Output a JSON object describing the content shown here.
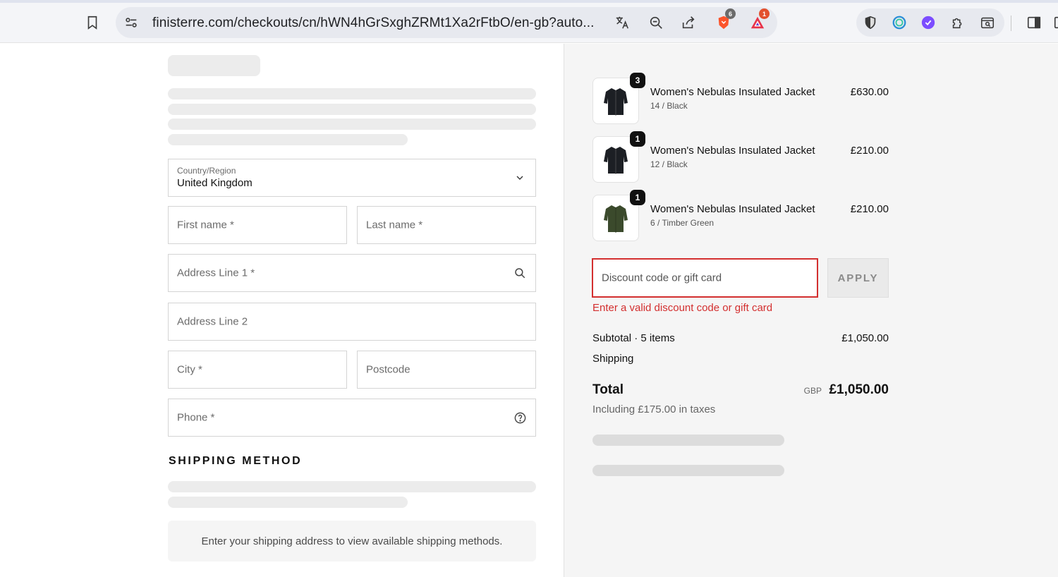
{
  "browser": {
    "url": "finisterre.com/checkouts/cn/hWN4hGrSxghZRMt1Xa2rFtbO/en-gb?auto...",
    "brave_badge": "6",
    "rewards_badge": "1",
    "icons": [
      "bookmark-icon",
      "site-settings-icon",
      "translate-icon",
      "zoom-out-icon",
      "share-icon",
      "brave-shields-icon",
      "brave-rewards-icon",
      "shield-extension-icon",
      "circle-extension-icon",
      "purple-extension-icon",
      "extensions-puzzle-icon",
      "tab-search-icon",
      "sidebar-icon"
    ]
  },
  "form": {
    "country_label": "Country/Region",
    "country_value": "United Kingdom",
    "first_name_placeholder": "First name *",
    "last_name_placeholder": "Last name *",
    "address1_placeholder": "Address Line 1 *",
    "address2_placeholder": "Address Line 2",
    "city_placeholder": "City *",
    "postcode_placeholder": "Postcode",
    "phone_placeholder": "Phone *"
  },
  "shipping": {
    "title": "SHIPPING METHOD",
    "note": "Enter your shipping address to view available shipping methods."
  },
  "order": {
    "items": [
      {
        "qty": "3",
        "name": "Women's Nebulas Insulated Jacket",
        "variant": "14 / Black",
        "price": "£630.00",
        "color": "#1c1f24"
      },
      {
        "qty": "1",
        "name": "Women's Nebulas Insulated Jacket",
        "variant": "12 / Black",
        "price": "£210.00",
        "color": "#1c1f24"
      },
      {
        "qty": "1",
        "name": "Women's Nebulas Insulated Jacket",
        "variant": "6 / Timber Green",
        "price": "£210.00",
        "color": "#3b4a2c"
      }
    ],
    "discount_placeholder": "Discount code or gift card",
    "apply_label": "APPLY",
    "discount_error": "Enter a valid discount code or gift card",
    "subtotal_label": "Subtotal · 5 items",
    "subtotal_value": "£1,050.00",
    "shipping_label": "Shipping",
    "total_label": "Total",
    "currency": "GBP",
    "total_value": "£1,050.00",
    "taxes_note": "Including £175.00 in taxes"
  },
  "colors": {
    "error": "#d32f2f",
    "skeleton": "#ececec"
  }
}
